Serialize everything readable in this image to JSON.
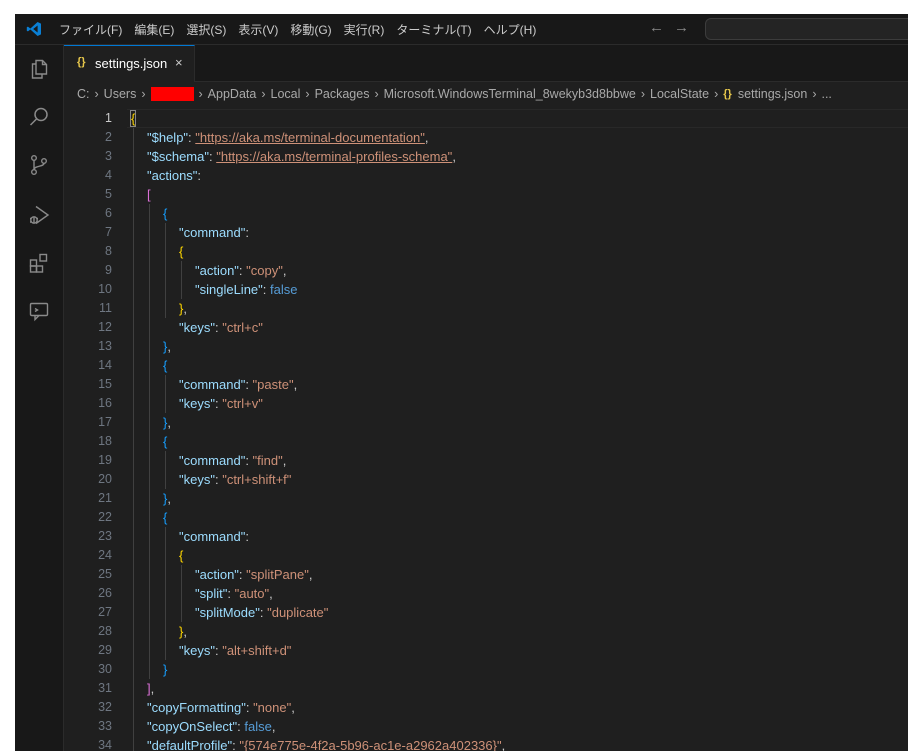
{
  "menus": [
    "ファイル(F)",
    "編集(E)",
    "選択(S)",
    "表示(V)",
    "移動(G)",
    "実行(R)",
    "ターミナル(T)",
    "ヘルプ(H)"
  ],
  "nav": {
    "back": "←",
    "forward": "→"
  },
  "tab": {
    "icon": "{}",
    "label": "settings.json",
    "close": "×"
  },
  "breadcrumb": {
    "before": [
      "C:",
      "Users"
    ],
    "after": [
      "AppData",
      "Local",
      "Packages",
      "Microsoft.WindowsTerminal_8wekyb3d8bbwe",
      "LocalState"
    ],
    "file_icon": "{}",
    "file": "settings.json",
    "more": "..."
  },
  "activity_icons": [
    "explorer-icon",
    "search-icon",
    "source-control-icon",
    "run-debug-icon",
    "extensions-icon",
    "remote-explorer-icon"
  ],
  "colors": {
    "accent": "#0078d4",
    "key": "#9cdcfe",
    "string": "#ce9178",
    "keyword": "#569cd6",
    "brace": "#ffd700"
  },
  "editor": {
    "active_line": 1,
    "line_numbers": [
      "1",
      "2",
      "3",
      "4",
      "5",
      "6",
      "7",
      "8",
      "9",
      "10",
      "11",
      "12",
      "13",
      "14",
      "15",
      "16",
      "17",
      "18",
      "19",
      "20",
      "21",
      "22",
      "23",
      "24",
      "25",
      "26",
      "27",
      "28",
      "29",
      "30",
      "31",
      "32",
      "33",
      "34"
    ],
    "t": {
      "l1_brace": "{",
      "l2_key": "\"$help\"",
      "l2_val": "\"https://aka.ms/terminal-documentation\"",
      "l3_key": "\"$schema\"",
      "l3_val": "\"https://aka.ms/terminal-profiles-schema\"",
      "l4_key": "\"actions\"",
      "l5_bracket": "[",
      "l6_brace": "{",
      "l7_key": "\"command\"",
      "l8_brace": "{",
      "l9_key": "\"action\"",
      "l9_val": "\"copy\"",
      "l10_key": "\"singleLine\"",
      "l10_val": "false",
      "l11_brace": "}",
      "l12_key": "\"keys\"",
      "l12_val": "\"ctrl+c\"",
      "l13_brace": "}",
      "l14_brace": "{",
      "l15_key": "\"command\"",
      "l15_val": "\"paste\"",
      "l16_key": "\"keys\"",
      "l16_val": "\"ctrl+v\"",
      "l17_brace": "}",
      "l18_brace": "{",
      "l19_key": "\"command\"",
      "l19_val": "\"find\"",
      "l20_key": "\"keys\"",
      "l20_val": "\"ctrl+shift+f\"",
      "l21_brace": "}",
      "l22_brace": "{",
      "l23_key": "\"command\"",
      "l24_brace": "{",
      "l25_key": "\"action\"",
      "l25_val": "\"splitPane\"",
      "l26_key": "\"split\"",
      "l26_val": "\"auto\"",
      "l27_key": "\"splitMode\"",
      "l27_val": "\"duplicate\"",
      "l28_brace": "}",
      "l29_key": "\"keys\"",
      "l29_val": "\"alt+shift+d\"",
      "l30_brace": "}",
      "l31_bracket": "]",
      "l32_key": "\"copyFormatting\"",
      "l32_val": "\"none\"",
      "l33_key": "\"copyOnSelect\"",
      "l33_val": "false",
      "l34_key": "\"defaultProfile\"",
      "l34_val": "\"{574e775e-4f2a-5b96-ac1e-a2962a402336}\""
    }
  }
}
